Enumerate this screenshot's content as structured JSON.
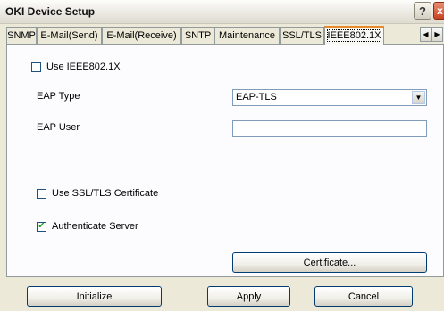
{
  "window": {
    "title": "OKI Device Setup",
    "help_label": "?",
    "close_label": "x"
  },
  "tabs": [
    {
      "label": "SNMP",
      "active": false
    },
    {
      "label": "E-Mail(Send)",
      "active": false
    },
    {
      "label": "E-Mail(Receive)",
      "active": false
    },
    {
      "label": "SNTP",
      "active": false
    },
    {
      "label": "Maintenance",
      "active": false
    },
    {
      "label": "SSL/TLS",
      "active": false
    },
    {
      "label": "IEEE802.1X",
      "active": true
    }
  ],
  "tab_scroll": {
    "left": "◀",
    "right": "▶"
  },
  "form": {
    "use_ieee": {
      "label": "Use IEEE802.1X",
      "checked": false,
      "mark": ""
    },
    "eap_type": {
      "label": "EAP Type",
      "value": "EAP-TLS",
      "arrow": "▼"
    },
    "eap_user": {
      "label": "EAP User",
      "value": ""
    },
    "use_ssl_cert": {
      "label": "Use SSL/TLS Certificate",
      "checked": false,
      "mark": ""
    },
    "auth_server": {
      "label": "Authenticate Server",
      "checked": true,
      "mark": "✔"
    },
    "certificate_button": "Certificate..."
  },
  "footer": {
    "initialize": "Initialize",
    "apply": "Apply",
    "cancel": "Cancel"
  }
}
